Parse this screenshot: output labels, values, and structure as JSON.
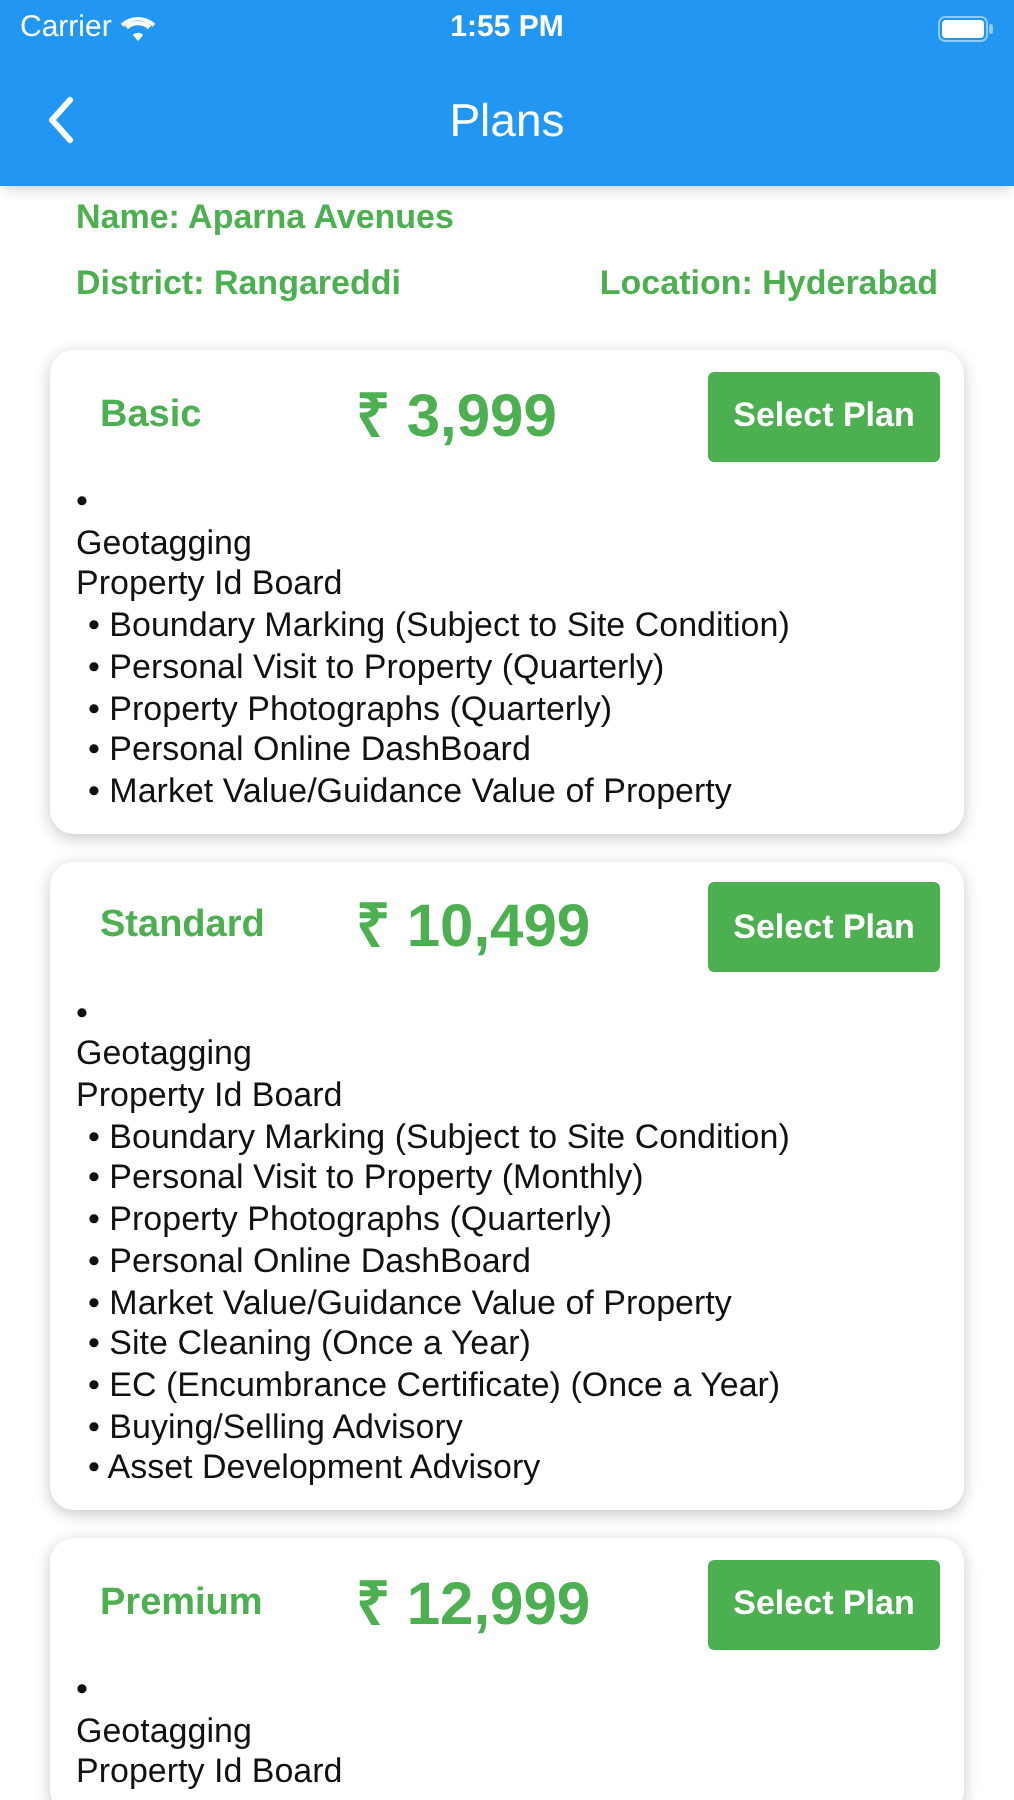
{
  "status_bar": {
    "carrier": "Carrier",
    "time": "1:55 PM"
  },
  "nav": {
    "title": "Plans"
  },
  "info": {
    "name": "Name: Aparna Avenues",
    "district": "District: Rangareddi",
    "location": "Location: Hyderabad"
  },
  "plans": [
    {
      "name": "Basic",
      "price": "₹ 3,999",
      "button": "Select Plan",
      "lines": [
        {
          "kind": "plain",
          "text": "•"
        },
        {
          "kind": "plain",
          "text": "Geotagging"
        },
        {
          "kind": "plain",
          "text": "Property Id Board"
        },
        {
          "kind": "bullet",
          "text": "• Boundary Marking (Subject to Site Condition)"
        },
        {
          "kind": "bullet",
          "text": "• Personal Visit to Property (Quarterly)"
        },
        {
          "kind": "bullet",
          "text": "• Property Photographs (Quarterly)"
        },
        {
          "kind": "bullet",
          "text": "• Personal Online DashBoard"
        },
        {
          "kind": "bullet",
          "text": "• Market Value/Guidance Value of Property"
        }
      ]
    },
    {
      "name": "Standard",
      "price": "₹ 10,499",
      "button": "Select Plan",
      "lines": [
        {
          "kind": "plain",
          "text": "•"
        },
        {
          "kind": "plain",
          "text": "Geotagging"
        },
        {
          "kind": "plain",
          "text": "Property Id Board"
        },
        {
          "kind": "bullet",
          "text": "• Boundary Marking (Subject to Site Condition)"
        },
        {
          "kind": "bullet",
          "text": "• Personal Visit to Property (Monthly)"
        },
        {
          "kind": "bullet",
          "text": "• Property Photographs (Quarterly)"
        },
        {
          "kind": "bullet",
          "text": "• Personal Online DashBoard"
        },
        {
          "kind": "bullet",
          "text": "• Market Value/Guidance Value of Property"
        },
        {
          "kind": "bullet",
          "text": "• Site Cleaning (Once a Year)"
        },
        {
          "kind": "bullet",
          "text": "• EC (Encumbrance Certificate) (Once a Year)"
        },
        {
          "kind": "bullet",
          "text": "• Buying/Selling Advisory"
        },
        {
          "kind": "bullet",
          "text": "• Asset Development Advisory"
        }
      ]
    },
    {
      "name": "Premium",
      "price": "₹ 12,999",
      "button": "Select Plan",
      "lines": [
        {
          "kind": "plain",
          "text": "•"
        },
        {
          "kind": "plain",
          "text": "Geotagging"
        },
        {
          "kind": "plain",
          "text": "Property Id Board"
        }
      ]
    }
  ]
}
